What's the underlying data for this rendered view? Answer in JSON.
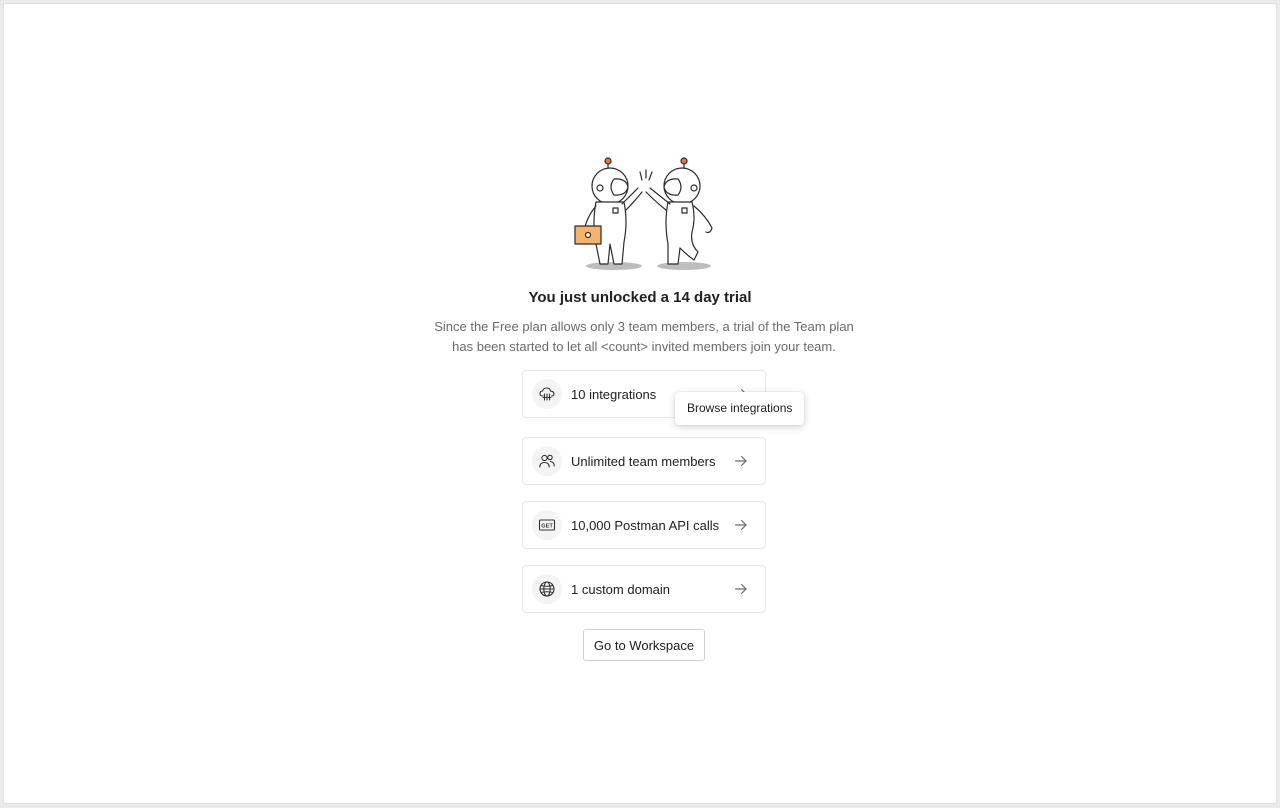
{
  "trial": {
    "title": "You just unlocked a 14 day trial",
    "description": "Since the Free plan allows only 3 team members, a trial of the Team plan has been started to let all <count> invited members join your team."
  },
  "features": [
    {
      "label": "10 integrations",
      "icon": "cloud-integration-icon"
    },
    {
      "label": "Unlimited team members",
      "icon": "team-members-icon"
    },
    {
      "label": "10,000 Postman API calls",
      "icon": "get-api-icon"
    },
    {
      "label": "1 custom domain",
      "icon": "globe-icon"
    }
  ],
  "tooltip": {
    "label": "Browse integrations"
  },
  "actions": {
    "go_to_workspace": "Go to Workspace"
  },
  "colors": {
    "accent": "#ff6c37",
    "box": "#f6b46a"
  }
}
